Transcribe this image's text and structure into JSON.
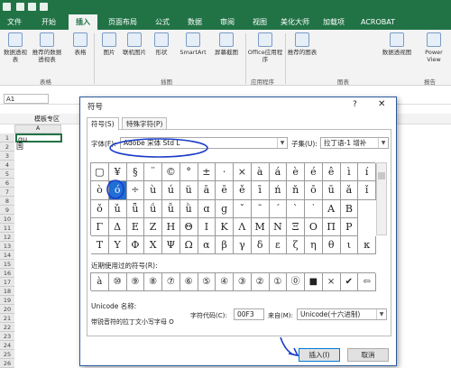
{
  "tabs": [
    "文件",
    "开始",
    "插入",
    "页面布局",
    "公式",
    "数据",
    "审阅",
    "视图",
    "美化大师",
    "加载项",
    "ACROBAT"
  ],
  "active_tab": "插入",
  "ribbon": {
    "buttons": [
      "数据透视表",
      "推荐的数据透视表",
      "表格",
      "图片",
      "联机图片",
      "形状",
      "SmartArt",
      "屏幕截图",
      "Office应用程序",
      "推荐的图表",
      "数据透视图",
      "Power View"
    ],
    "groups": [
      "表格",
      "插图",
      "应用程序",
      "图表",
      "报告"
    ]
  },
  "namebox": "A1",
  "sheet_tab": "模板专区",
  "grid": {
    "col": "A",
    "rows": [
      "1",
      "2",
      "3",
      "4",
      "5",
      "6",
      "7",
      "8",
      "9",
      "10",
      "11",
      "12",
      "13",
      "14",
      "15",
      "16",
      "17",
      "18",
      "19",
      "20",
      "21",
      "22",
      "23",
      "24",
      "25",
      "26"
    ],
    "a1": "gu",
    "a2": "国"
  },
  "dialog": {
    "title": "符号",
    "help": "?",
    "close": "✕",
    "tab_symbols": "符号(S)",
    "tab_special": "特殊字符(P)",
    "font_label": "字体(F):",
    "font_value": "Adobe 宋体 Std L",
    "subset_label": "子集(U):",
    "subset_value": "拉丁语-1 增补",
    "symbols": [
      [
        "▢",
        "¥",
        "§",
        "¨",
        "©",
        "°",
        "±",
        "·",
        "×",
        "à",
        "á",
        "è",
        "é",
        "ê",
        "ì",
        "í"
      ],
      [
        "ò",
        "ó",
        "÷",
        "ù",
        "ú",
        "ü",
        "ā",
        "ē",
        "ě",
        "ī",
        "ń",
        "ň",
        "ō",
        "ū",
        "ǎ",
        "ǐ"
      ],
      [
        "ǒ",
        "ǔ",
        "ǖ",
        "ǘ",
        "ǚ",
        "ǜ",
        "ɑ",
        "ɡ",
        "ˇ",
        "ˉ",
        "ˊ",
        "ˋ",
        "˙",
        "Α",
        "Β"
      ],
      [
        "Γ",
        "Δ",
        "Ε",
        "Ζ",
        "Η",
        "Θ",
        "Ι",
        "Κ",
        "Λ",
        "Μ",
        "Ν",
        "Ξ",
        "Ο",
        "Π",
        "Ρ"
      ],
      [
        "Τ",
        "Υ",
        "Φ",
        "Χ",
        "Ψ",
        "Ω",
        "α",
        "β",
        "γ",
        "δ",
        "ε",
        "ζ",
        "η",
        "θ",
        "ι",
        "κ"
      ]
    ],
    "recent_label": "近期使用过的符号(R):",
    "recent": [
      "à",
      "⑩",
      "⑨",
      "⑧",
      "⑦",
      "⑥",
      "⑤",
      "④",
      "③",
      "②",
      "①",
      "⓪",
      "■",
      "×",
      "✔",
      "⇦"
    ],
    "unicode_label": "Unicode 名称:",
    "unicode_name": "带锐音符的拉丁文小写字母 O",
    "charcode_label": "字符代码(C):",
    "charcode_value": "00F3",
    "from_label": "来自(M):",
    "from_value": "Unicode(十六进制)",
    "insert_button": "插入(I)",
    "cancel_button": "取消"
  },
  "colors": {
    "excel_green": "#217346",
    "highlight": "#1f6fd6",
    "annotation": "#1a3cc9"
  }
}
